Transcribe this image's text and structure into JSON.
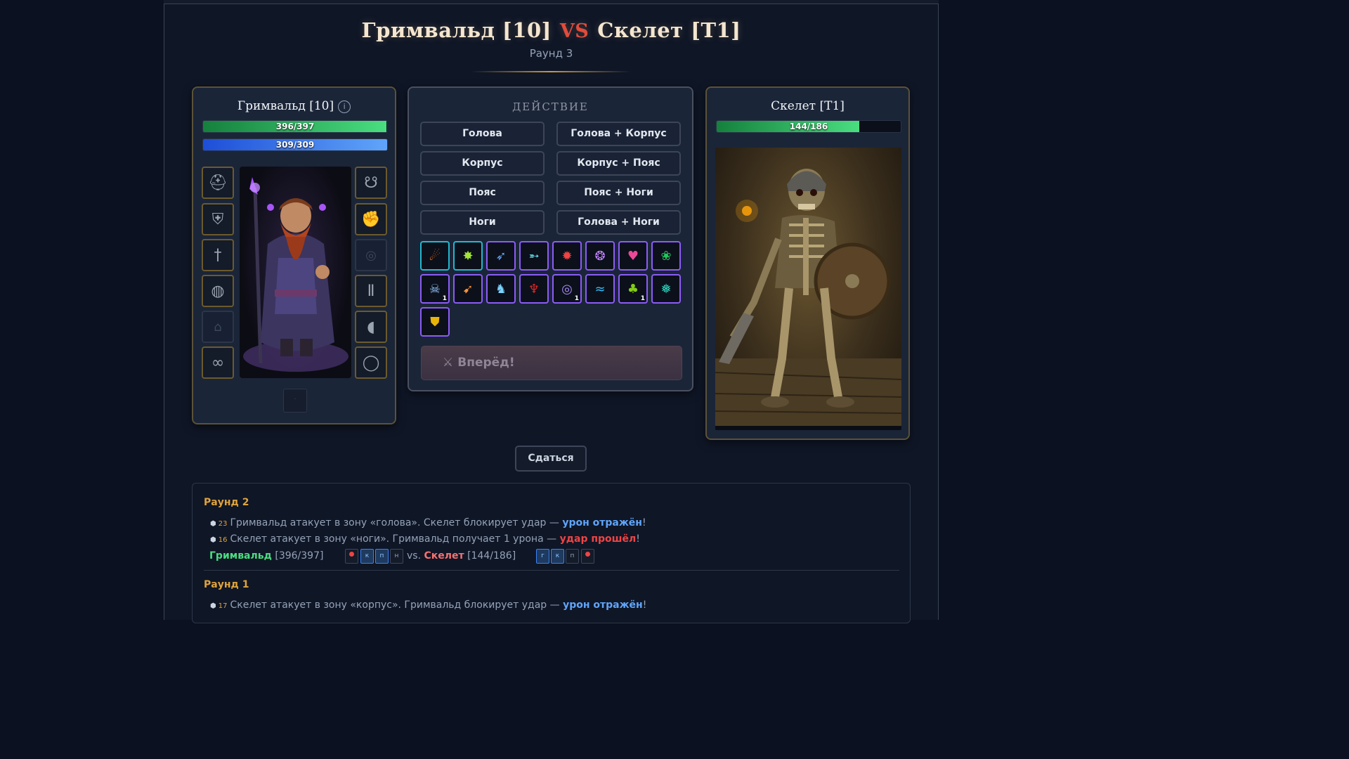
{
  "header": {
    "player": "Гримвальд [10]",
    "vs": "VS",
    "enemy": "Скелет [Т1]",
    "round": "Раунд 3"
  },
  "player": {
    "name": "Гримвальд [10]",
    "info_icon": "i",
    "hp": "396/397",
    "hp_fraction": 0.997,
    "mp": "309/309",
    "mp_fraction": 1.0,
    "slots": [
      "helmet",
      "armor",
      "weapon",
      "belt",
      "empty-cloak",
      "gloves-alt",
      "amulet",
      "gloves",
      "empty-ring",
      "pants",
      "boots",
      "ring"
    ],
    "belt_slot": "·"
  },
  "action": {
    "title": "ДЕЙСТВИЕ",
    "zones": [
      "Голова",
      "Голова + Корпус",
      "Корпус",
      "Корпус + Пояс",
      "Пояс",
      "Пояс + Ноги",
      "Ноги",
      "Голова + Ноги"
    ],
    "skills": [
      {
        "icon": "fireball-icon",
        "glyph": "☄",
        "color": "#f97316",
        "count": ""
      },
      {
        "icon": "poison-burst-icon",
        "glyph": "✸",
        "color": "#a3e635",
        "count": ""
      },
      {
        "icon": "arcane-bolt-icon",
        "glyph": "➶",
        "color": "#60a5fa",
        "count": ""
      },
      {
        "icon": "ice-lance-icon",
        "glyph": "➵",
        "color": "#67e8f9",
        "count": ""
      },
      {
        "icon": "explosion-icon",
        "glyph": "✹",
        "color": "#ef4444",
        "count": ""
      },
      {
        "icon": "spirit-icon",
        "glyph": "❂",
        "color": "#c084fc",
        "count": ""
      },
      {
        "icon": "heart-icon",
        "glyph": "♥",
        "color": "#ec4899",
        "count": ""
      },
      {
        "icon": "nature-icon",
        "glyph": "❀",
        "color": "#22c55e",
        "count": ""
      },
      {
        "icon": "skull-orb-icon",
        "glyph": "☠",
        "color": "#93c5fd",
        "count": "1"
      },
      {
        "icon": "flame-dart-icon",
        "glyph": "➹",
        "color": "#fb923c",
        "count": ""
      },
      {
        "icon": "summon-icon",
        "glyph": "♞",
        "color": "#7dd3fc",
        "count": ""
      },
      {
        "icon": "demon-icon",
        "glyph": "♆",
        "color": "#dc2626",
        "count": ""
      },
      {
        "icon": "vortex-icon",
        "glyph": "◎",
        "color": "#a78bfa",
        "count": "1"
      },
      {
        "icon": "lightning-icon",
        "glyph": "≈",
        "color": "#38bdf8",
        "count": ""
      },
      {
        "icon": "goblin-icon",
        "glyph": "♣",
        "color": "#84cc16",
        "count": "1"
      },
      {
        "icon": "tornado-icon",
        "glyph": "❅",
        "color": "#2dd4bf",
        "count": ""
      },
      {
        "icon": "golden-shield-icon",
        "glyph": "⛊",
        "color": "#eab308",
        "count": ""
      }
    ],
    "go_label": "Вперёд!",
    "go_icon": "⚔"
  },
  "enemy": {
    "name": "Скелет [Т1]",
    "hp": "144/186",
    "hp_fraction": 0.774
  },
  "surrender_label": "Сдаться",
  "log": {
    "round2_title": "Раунд 2",
    "r2_l1_roll": "23",
    "r2_l1_text": "Гримвальд атакует в зону «голова». Скелет блокирует удар — ",
    "r2_l1_result": "урон отражён",
    "r2_l2_roll": "16",
    "r2_l2_text": "Скелет атакует в зону «ноги». Гримвальд получает 1 урона — ",
    "r2_l2_result": "удар прошёл",
    "excl": "!",
    "stat_player": "Гримвальд",
    "stat_player_hp": "[396/397]",
    "stat_vs": "vs.",
    "stat_enemy": "Скелет",
    "stat_enemy_hp": "[144/186]",
    "player_chips": [
      "",
      "к",
      "п",
      "н"
    ],
    "enemy_chips": [
      "г",
      "к",
      "п",
      ""
    ],
    "round1_title": "Раунд 1",
    "r1_l1_roll": "17",
    "r1_l1_text": "Скелет атакует в зону «корпус». Гримвальд блокирует удар — ",
    "r1_l1_result": "урон отражён"
  }
}
